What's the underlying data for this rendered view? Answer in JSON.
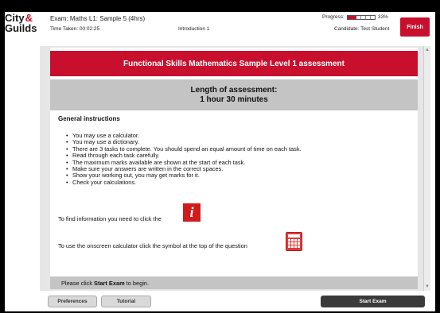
{
  "header": {
    "logo_line1": "City",
    "logo_amp": "&",
    "logo_line2": "Guilds",
    "exam_title": "Exam: Maths L1: Sample 5 (4hrs)",
    "time_taken": "Time Taken: 00:02:25",
    "section": "Introduction 1",
    "progress_label": "Progress:",
    "progress_percent": "33%",
    "progress_fraction": 0.33,
    "candidate": "Candidate: Test Student",
    "finish_label": "Finish"
  },
  "content": {
    "banner_title": "Functional Skills Mathematics Sample Level 1 assessment",
    "length_line1": "Length of assessment:",
    "length_line2": "1 hour 30 minutes",
    "general_title": "General instructions",
    "instructions": [
      "You may use a calculator.",
      "You may use a dictionary.",
      "There are 3 tasks to complete. You should spend an equal amount of time on each task.",
      "Read through each task carefully.",
      "The maximum marks available are shown at the start of each task.",
      "Make sure your answers are written in the correct spaces.",
      "Show your working out, you may get marks for it.",
      "Check your calculations."
    ],
    "info_text": "To find information you need to click the",
    "info_icon_glyph": "i",
    "calc_text": "To use the onscreen calculator click the symbol at the top of the question",
    "begin_prefix": "Please click",
    "begin_bold": "Start Exam",
    "begin_suffix": "to begin."
  },
  "footer": {
    "preferences_label": "Preferences",
    "tutorial_label": "Tutorial",
    "start_label": "Start Exam"
  },
  "colors": {
    "brand_red": "#c8102e",
    "grey_band": "#c4c4c4",
    "dark_button": "#3a3a3a"
  }
}
